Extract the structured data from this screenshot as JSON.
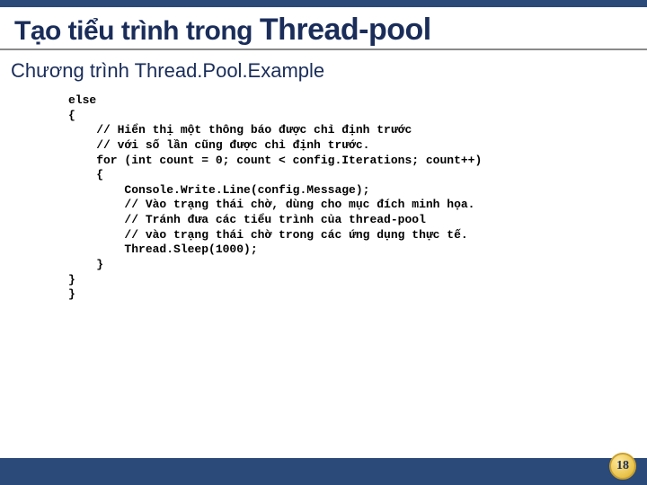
{
  "title_prefix": "Tạo tiểu trình trong ",
  "title_main": "Thread-pool",
  "subtitle": "Chương trình Thread.Pool.Example",
  "code": "else\n{\n    // Hiển thị một thông báo được chỉ định trước\n    // với số lần cũng được chỉ định trước.\n    for (int count = 0; count < config.Iterations; count++)\n    {\n        Console.Write.Line(config.Message);\n        // Vào trạng thái chờ, dùng cho mục đích minh họa.\n        // Tránh đưa các tiểu trình của thread-pool\n        // vào trạng thái chờ trong các ứng dụng thực tế.\n        Thread.Sleep(1000);\n    }\n}\n}",
  "page_number": "18"
}
